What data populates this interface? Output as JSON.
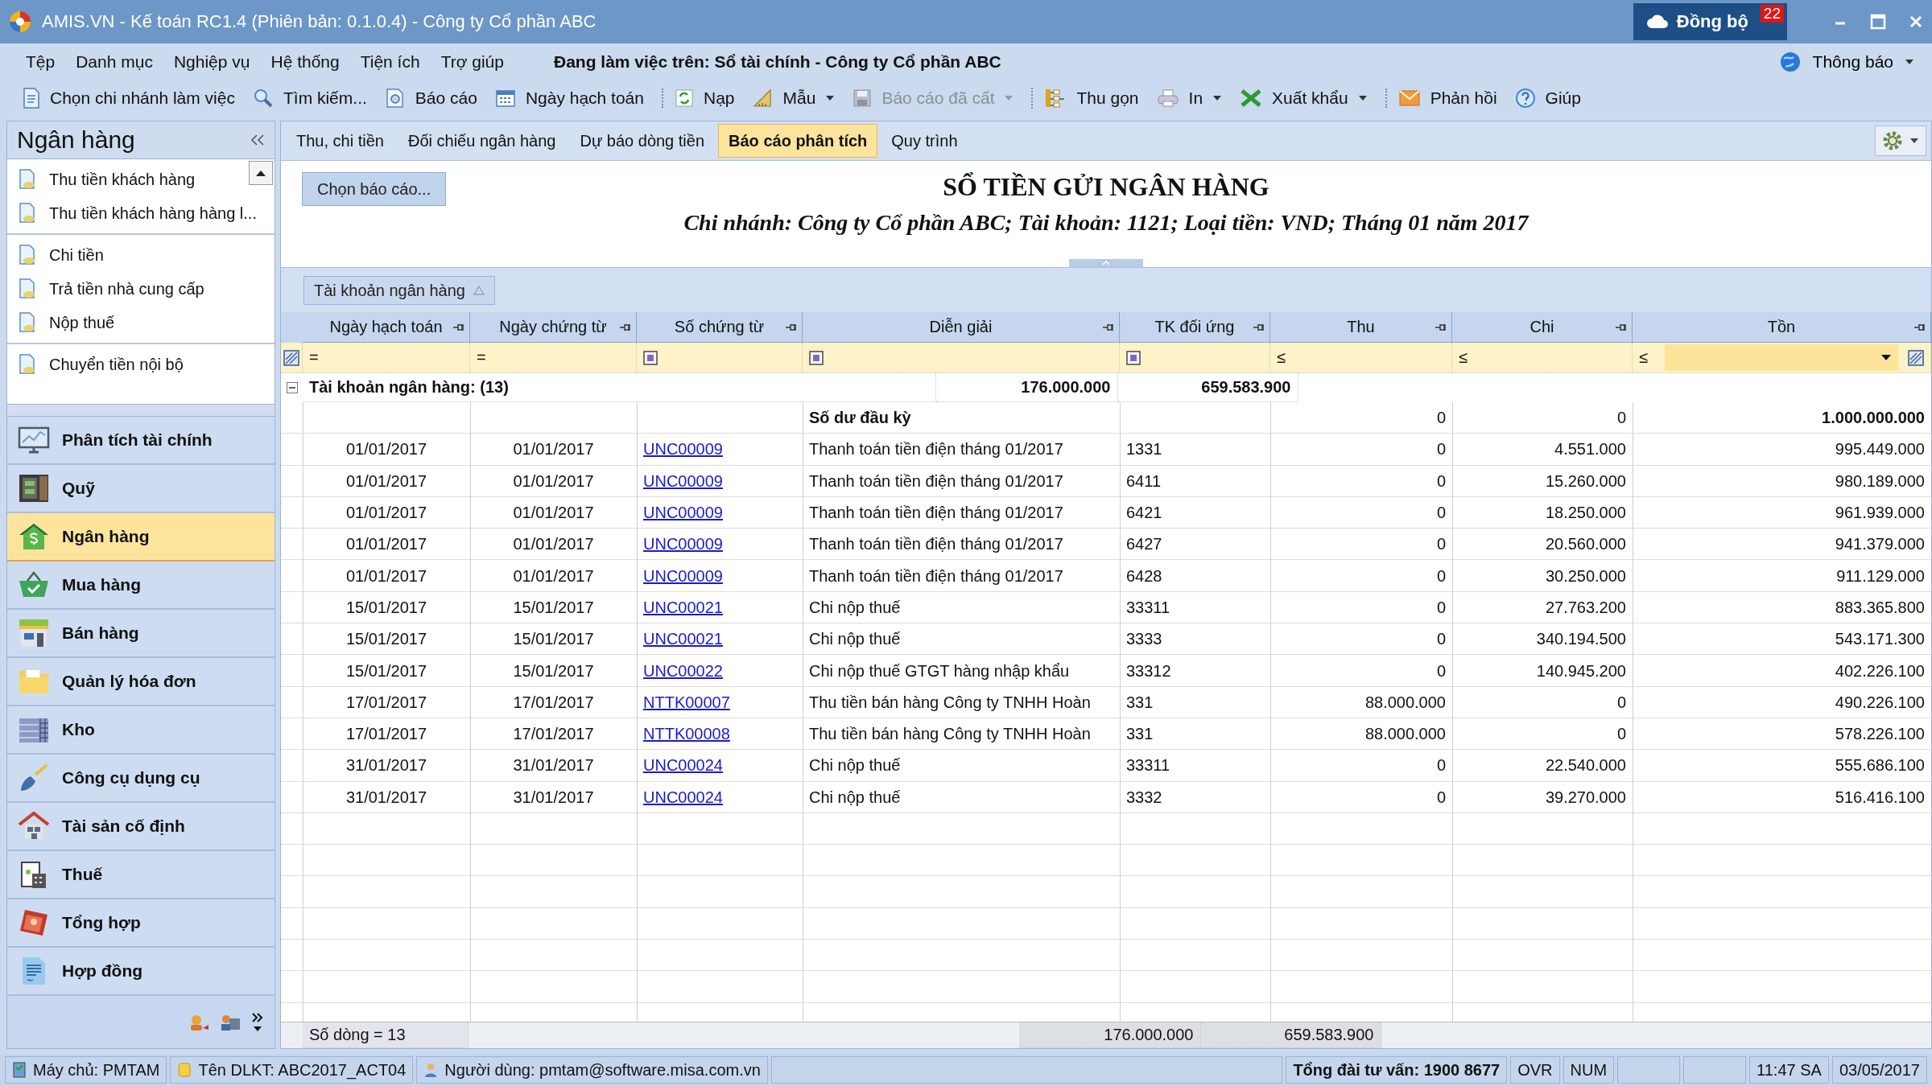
{
  "window": {
    "title": "AMIS.VN - Kế toán RC1.4 (Phiên bản: 0.1.0.4) - Công ty Cổ phần ABC",
    "sync_label": "Đồng bộ",
    "sync_count": "22"
  },
  "menu": [
    "Tệp",
    "Danh mục",
    "Nghiệp vụ",
    "Hệ thống",
    "Tiện ích",
    "Trợ giúp"
  ],
  "working_on": "Đang làm việc trên: Sổ tài chính - Công ty Cổ phần ABC",
  "notification": "Thông báo",
  "toolbar": [
    {
      "label": "Chọn chi nhánh làm việc",
      "dropdown": false,
      "disabled": false,
      "separator_before": false
    },
    {
      "label": "Tìm kiếm...",
      "dropdown": false,
      "disabled": false,
      "separator_before": false
    },
    {
      "label": "Báo cáo",
      "dropdown": false,
      "disabled": false,
      "separator_before": false
    },
    {
      "label": "Ngày hạch toán",
      "dropdown": false,
      "disabled": false,
      "separator_before": false
    },
    {
      "label": "Nạp",
      "dropdown": false,
      "disabled": false,
      "separator_before": true
    },
    {
      "label": "Mẫu",
      "dropdown": true,
      "disabled": false,
      "separator_before": false
    },
    {
      "label": "Báo cáo đã cất",
      "dropdown": true,
      "disabled": true,
      "separator_before": false
    },
    {
      "label": "Thu gọn",
      "dropdown": false,
      "disabled": false,
      "separator_before": true
    },
    {
      "label": "In",
      "dropdown": true,
      "disabled": false,
      "separator_before": false
    },
    {
      "label": "Xuất khẩu",
      "dropdown": true,
      "disabled": false,
      "separator_before": false
    },
    {
      "label": "Phản hồi",
      "dropdown": false,
      "disabled": false,
      "separator_before": true
    },
    {
      "label": "Giúp",
      "dropdown": false,
      "disabled": false,
      "separator_before": false
    }
  ],
  "sidebar": {
    "title": "Ngân hàng",
    "task_groups": [
      [
        "Thu tiền khách hàng",
        "Thu tiền khách hàng hàng l..."
      ],
      [
        "Chi tiền",
        "Trả tiền nhà cung cấp",
        "Nộp thuế"
      ],
      [
        "Chuyển tiền nội bộ"
      ]
    ],
    "modules": [
      {
        "label": "Phân tích tài chính",
        "selected": false
      },
      {
        "label": "Quỹ",
        "selected": false
      },
      {
        "label": "Ngân hàng",
        "selected": true
      },
      {
        "label": "Mua hàng",
        "selected": false
      },
      {
        "label": "Bán hàng",
        "selected": false
      },
      {
        "label": "Quản lý hóa đơn",
        "selected": false
      },
      {
        "label": "Kho",
        "selected": false
      },
      {
        "label": "Công cụ dụng cụ",
        "selected": false
      },
      {
        "label": "Tài sản cố định",
        "selected": false
      },
      {
        "label": "Thuế",
        "selected": false
      },
      {
        "label": "Tổng hợp",
        "selected": false
      },
      {
        "label": "Hợp đồng",
        "selected": false
      }
    ]
  },
  "tabs": [
    {
      "label": "Thu, chi tiền",
      "selected": false
    },
    {
      "label": "Đối chiếu ngân hàng",
      "selected": false
    },
    {
      "label": "Dự báo dòng tiền",
      "selected": false
    },
    {
      "label": "Báo cáo phân tích",
      "selected": true
    },
    {
      "label": "Quy trình",
      "selected": false
    }
  ],
  "report": {
    "choose_button": "Chọn báo cáo...",
    "title": "SỔ TIỀN GỬI NGÂN HÀNG",
    "subtitle": "Chi nhánh: Công ty Cổ phần ABC; Tài khoản: 1121; Loại tiền: VND; Tháng 01 năm 2017"
  },
  "table": {
    "group_by": "Tài khoản ngân hàng",
    "columns": [
      {
        "label": "Ngày hạch toán"
      },
      {
        "label": "Ngày chứng từ"
      },
      {
        "label": "Số chứng từ"
      },
      {
        "label": "Diễn giải"
      },
      {
        "label": "TK đối ứng"
      },
      {
        "label": "Thu"
      },
      {
        "label": "Chi"
      },
      {
        "label": "Tồn"
      }
    ],
    "filters": [
      {
        "kind": "op",
        "op": "="
      },
      {
        "kind": "op",
        "op": "="
      },
      {
        "kind": "square"
      },
      {
        "kind": "square"
      },
      {
        "kind": "square"
      },
      {
        "kind": "op",
        "op": "≤"
      },
      {
        "kind": "op",
        "op": "≤"
      },
      {
        "kind": "dropdown",
        "op": "≤"
      }
    ],
    "group": {
      "label": "Tài khoản ngân hàng: (13)",
      "thu": "176.000.000",
      "chi": "659.583.900"
    },
    "rows": [
      {
        "kind": "opening",
        "cells": [
          "",
          "",
          "",
          "Số dư đầu kỳ",
          "",
          "0",
          "0",
          "1.000.000.000"
        ]
      },
      {
        "kind": "entry",
        "cells": [
          "01/01/2017",
          "01/01/2017",
          "UNC00009",
          "Thanh toán tiền điện tháng 01/2017",
          "1331",
          "0",
          "4.551.000",
          "995.449.000"
        ]
      },
      {
        "kind": "entry",
        "cells": [
          "01/01/2017",
          "01/01/2017",
          "UNC00009",
          "Thanh toán tiền điện tháng 01/2017",
          "6411",
          "0",
          "15.260.000",
          "980.189.000"
        ]
      },
      {
        "kind": "entry",
        "cells": [
          "01/01/2017",
          "01/01/2017",
          "UNC00009",
          "Thanh toán tiền điện tháng 01/2017",
          "6421",
          "0",
          "18.250.000",
          "961.939.000"
        ]
      },
      {
        "kind": "entry",
        "cells": [
          "01/01/2017",
          "01/01/2017",
          "UNC00009",
          "Thanh toán tiền điện tháng 01/2017",
          "6427",
          "0",
          "20.560.000",
          "941.379.000"
        ]
      },
      {
        "kind": "entry",
        "cells": [
          "01/01/2017",
          "01/01/2017",
          "UNC00009",
          "Thanh toán tiền điện tháng 01/2017",
          "6428",
          "0",
          "30.250.000",
          "911.129.000"
        ]
      },
      {
        "kind": "entry",
        "cells": [
          "15/01/2017",
          "15/01/2017",
          "UNC00021",
          "Chi nộp thuế",
          "33311",
          "0",
          "27.763.200",
          "883.365.800"
        ]
      },
      {
        "kind": "entry",
        "cells": [
          "15/01/2017",
          "15/01/2017",
          "UNC00021",
          "Chi nộp thuế",
          "3333",
          "0",
          "340.194.500",
          "543.171.300"
        ]
      },
      {
        "kind": "entry",
        "cells": [
          "15/01/2017",
          "15/01/2017",
          "UNC00022",
          "Chi nộp thuế GTGT hàng nhập khẩu",
          "33312",
          "0",
          "140.945.200",
          "402.226.100"
        ]
      },
      {
        "kind": "entry",
        "cells": [
          "17/01/2017",
          "17/01/2017",
          "NTTK00007",
          "Thu tiền bán hàng Công ty TNHH Hoàn",
          "331",
          "88.000.000",
          "0",
          "490.226.100"
        ]
      },
      {
        "kind": "entry",
        "cells": [
          "17/01/2017",
          "17/01/2017",
          "NTTK00008",
          "Thu tiền bán hàng Công ty TNHH Hoàn",
          "331",
          "88.000.000",
          "0",
          "578.226.100"
        ]
      },
      {
        "kind": "entry",
        "cells": [
          "31/01/2017",
          "31/01/2017",
          "UNC00024",
          "Chi nộp thuế",
          "33311",
          "0",
          "22.540.000",
          "555.686.100"
        ]
      },
      {
        "kind": "entry",
        "cells": [
          "31/01/2017",
          "31/01/2017",
          "UNC00024",
          "Chi nộp thuế",
          "3332",
          "0",
          "39.270.000",
          "516.416.100"
        ]
      }
    ],
    "footer": {
      "count": "Số dòng = 13",
      "thu": "176.000.000",
      "chi": "659.583.900"
    }
  },
  "status_bar": [
    {
      "text": "Máy chủ: PMTAM",
      "kind": "server"
    },
    {
      "text": "Tên DLKT: ABC2017_ACT04",
      "kind": "database"
    },
    {
      "text": "Người dùng: pmtam@software.misa.com.vn",
      "kind": "user"
    },
    {
      "text": "Tổng đài tư vấn: 1900 8677",
      "kind": "hotline"
    },
    {
      "text": "OVR",
      "kind": "plain"
    },
    {
      "text": "NUM",
      "kind": "plain"
    },
    {
      "text": "11:47 SA",
      "kind": "plain"
    },
    {
      "text": "03/05/2017",
      "kind": "plain"
    }
  ]
}
